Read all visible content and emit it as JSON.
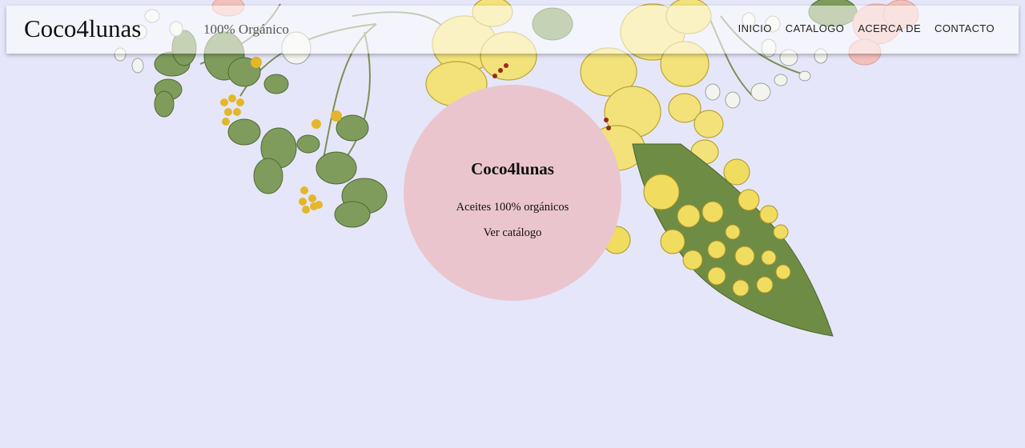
{
  "header": {
    "brand": "Coco4lunas",
    "tagline": "100% Orgánico",
    "nav": [
      "INICIO",
      "CATALOGO",
      "ACERCA DE",
      "CONTACTO"
    ]
  },
  "hero": {
    "title": "Coco4lunas",
    "subtitle": "Aceites 100% orgánicos",
    "cta": "Ver catálogo"
  },
  "colors": {
    "background": "#e6e6fa",
    "circle": "#ebc5cd",
    "leaf": "#7a9a55",
    "flower_yellow": "#f3e27a"
  }
}
